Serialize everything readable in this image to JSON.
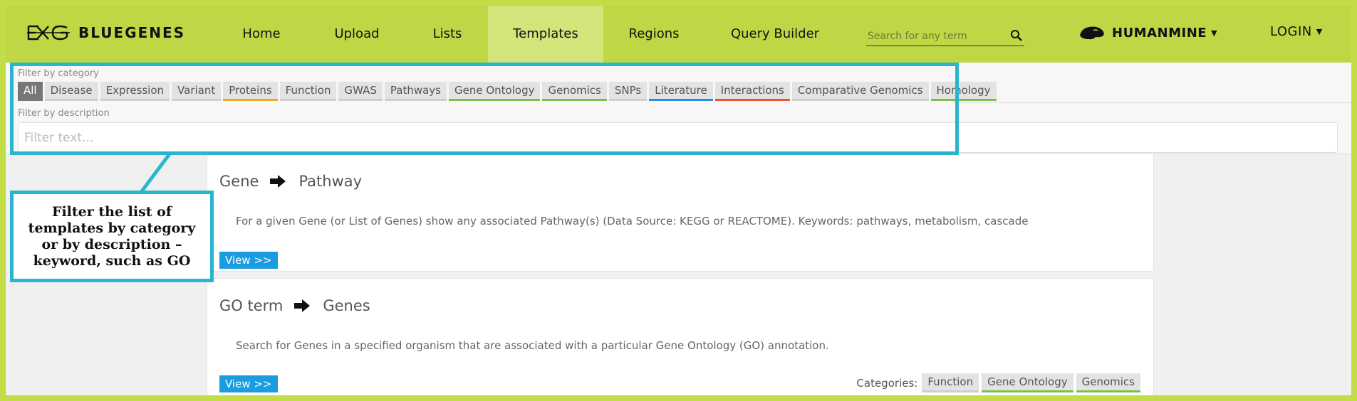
{
  "brand": {
    "name": "BLUEGENES"
  },
  "nav": {
    "items": [
      {
        "label": "Home"
      },
      {
        "label": "Upload"
      },
      {
        "label": "Lists"
      },
      {
        "label": "Templates",
        "active": true
      },
      {
        "label": "Regions"
      },
      {
        "label": "Query Builder"
      }
    ],
    "search_placeholder": "Search for any term",
    "mine_label": "HUMANMINE",
    "login_label": "LOGIN"
  },
  "filters": {
    "category_label": "Filter by category",
    "categories": [
      {
        "label": "All",
        "active": true
      },
      {
        "label": "Disease"
      },
      {
        "label": "Expression"
      },
      {
        "label": "Variant"
      },
      {
        "label": "Proteins",
        "color": "#f5a623"
      },
      {
        "label": "Function"
      },
      {
        "label": "GWAS"
      },
      {
        "label": "Pathways"
      },
      {
        "label": "Gene Ontology",
        "color": "#7cc04a"
      },
      {
        "label": "Genomics",
        "color": "#7cc04a"
      },
      {
        "label": "SNPs"
      },
      {
        "label": "Literature",
        "color": "#2a8fe0"
      },
      {
        "label": "Interactions",
        "color": "#e8542c"
      },
      {
        "label": "Comparative Genomics"
      },
      {
        "label": "Homology",
        "color": "#7cc04a"
      }
    ],
    "description_label": "Filter by description",
    "description_placeholder": "Filter text..."
  },
  "templates": [
    {
      "from": "Gene",
      "to": "Pathway",
      "description": "For a given Gene (or List of Genes) show any associated Pathway(s) (Data Source: KEGG or REACTOME). Keywords: pathways, metabolism, cascade",
      "view_label": "View >>"
    },
    {
      "from": "GO term",
      "to": "Genes",
      "description": "Search for Genes in a specified organism that are associated with a particular Gene Ontology (GO) annotation.",
      "view_label": "View >>",
      "categories_label": "Categories:",
      "categories": [
        {
          "label": "Function"
        },
        {
          "label": "Gene Ontology",
          "color": "#7cc04a"
        },
        {
          "label": "Genomics",
          "color": "#7cc04a"
        }
      ]
    }
  ],
  "annotation": {
    "text": "Filter the list of templates by category or by description – keyword, such as GO",
    "color": "#29b5cf"
  },
  "colors": {
    "navbar": "#bfd745",
    "active_nav": "#d2e47a",
    "view_button": "#1a9ce0"
  }
}
